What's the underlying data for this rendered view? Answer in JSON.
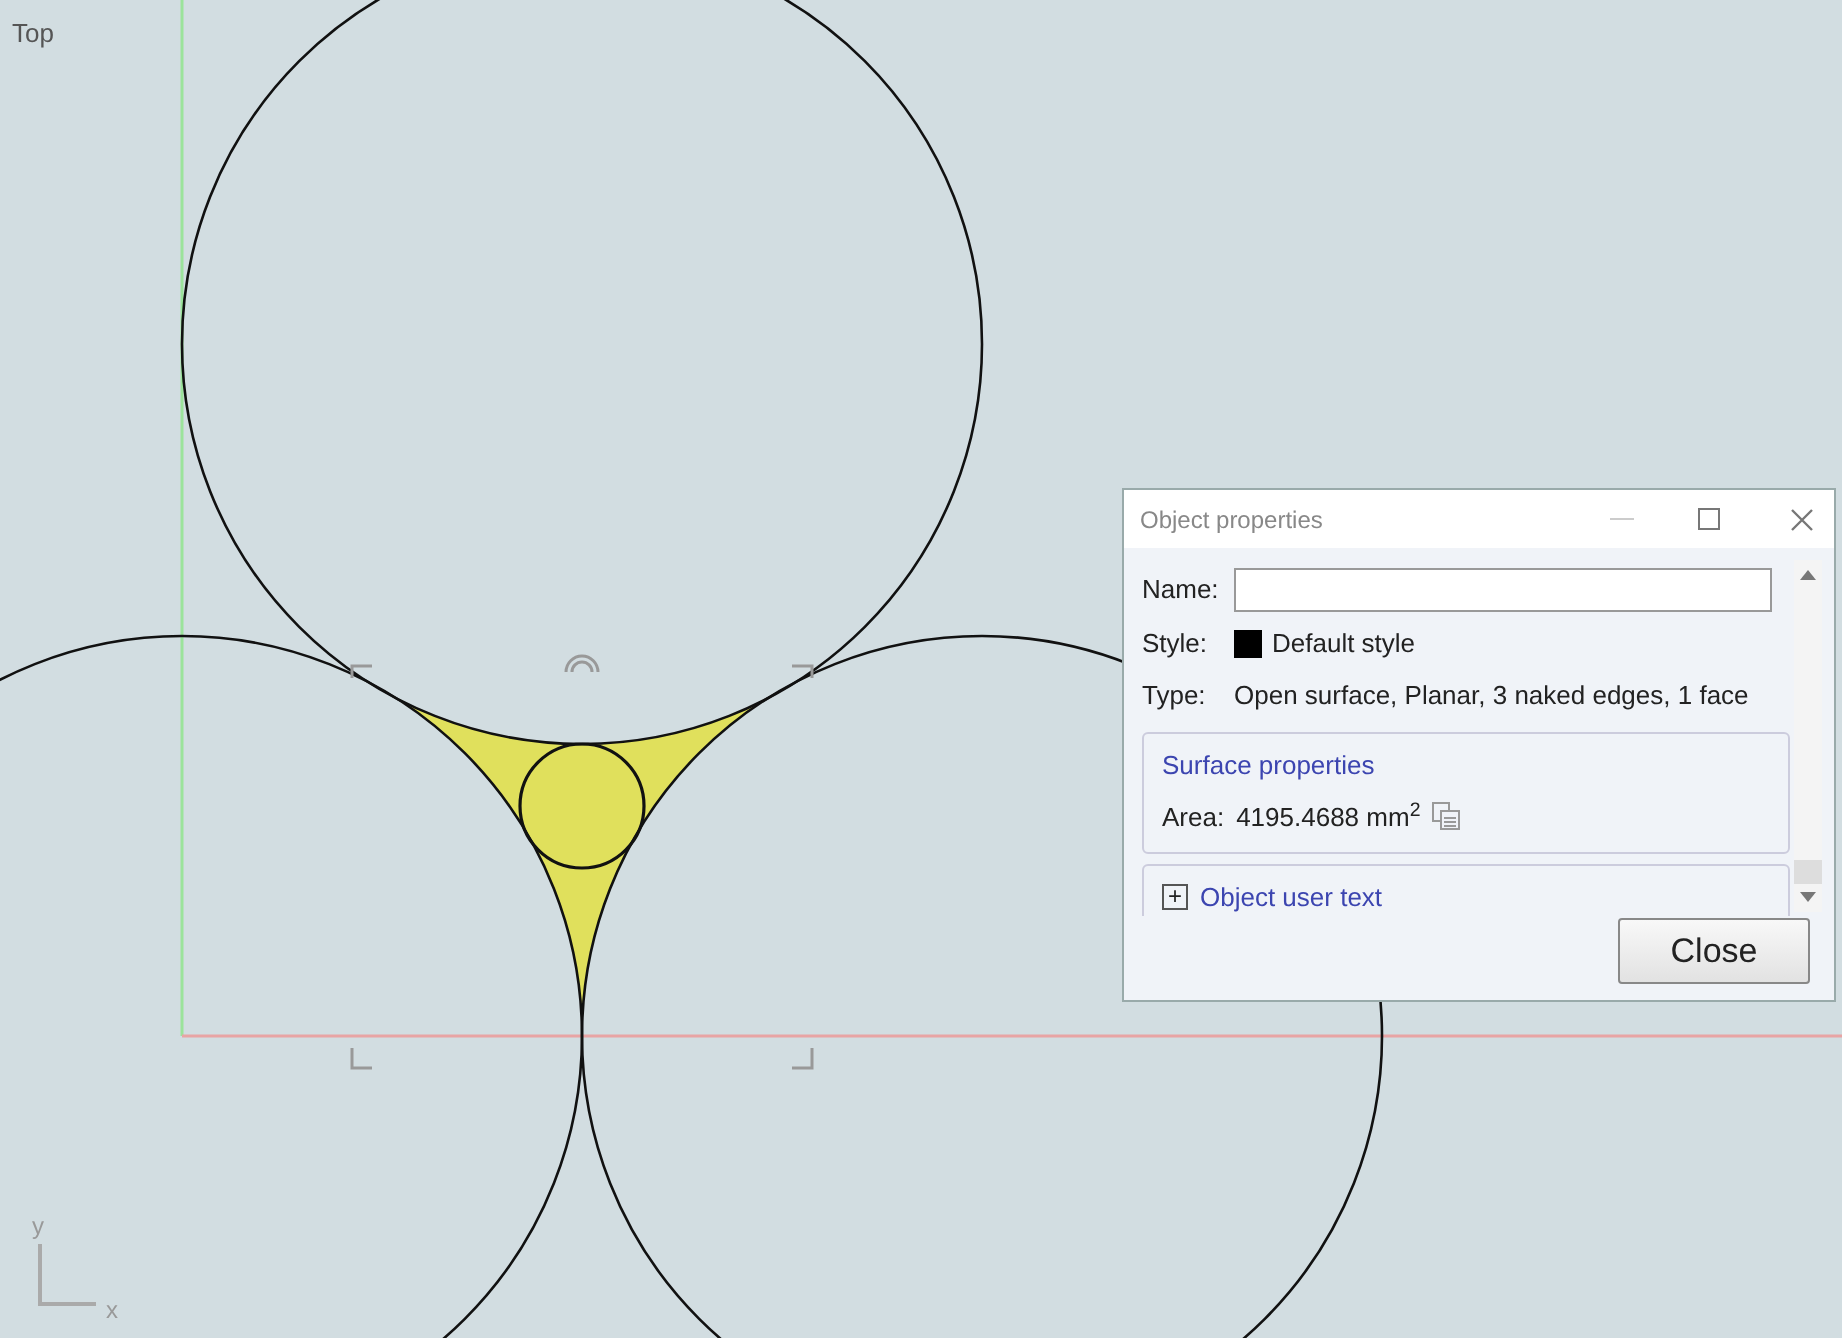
{
  "viewport": {
    "label": "Top",
    "axis_labels": [
      "y",
      "x"
    ]
  },
  "dialog": {
    "title": "Object properties",
    "fields": [
      {
        "kind": "input",
        "label": "Name:"
      },
      {
        "kind": "swatch",
        "label": "Style:",
        "value": "Default style",
        "color": "#000000"
      },
      {
        "kind": "text",
        "label": "Type:",
        "value": "Open surface, Planar, 3 naked edges, 1 face"
      }
    ],
    "sections": [
      {
        "title": "Surface properties",
        "expanded": true,
        "rows": [
          {
            "label": "Area:",
            "value": "4195.4688 mm$^{2}$"
          }
        ]
      },
      {
        "title": "Object user text",
        "expanded": false,
        "toggle": "+"
      }
    ],
    "buttons": [
      "Close"
    ]
  }
}
